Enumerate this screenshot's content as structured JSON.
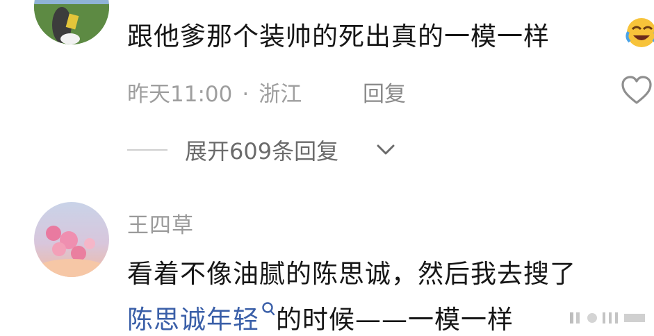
{
  "comment1": {
    "text": "跟他爹那个装帅的死出真的一模一样",
    "time": "昨天11:00",
    "separator": "·",
    "location": "浙江",
    "reply_label": "回复",
    "emoji_icon": "crying-laughing-emoji"
  },
  "thread": {
    "expand_label": "展开609条回复"
  },
  "comment2": {
    "author": "王四草",
    "line1": "看着不像油腻的陈思诚，然后我去搜了",
    "link_text": "陈思诚年轻",
    "line2_rest": "的时候——一模一样"
  },
  "colors": {
    "text": "#161616",
    "meta": "#9e9e9e",
    "link": "#3a5fa8"
  }
}
